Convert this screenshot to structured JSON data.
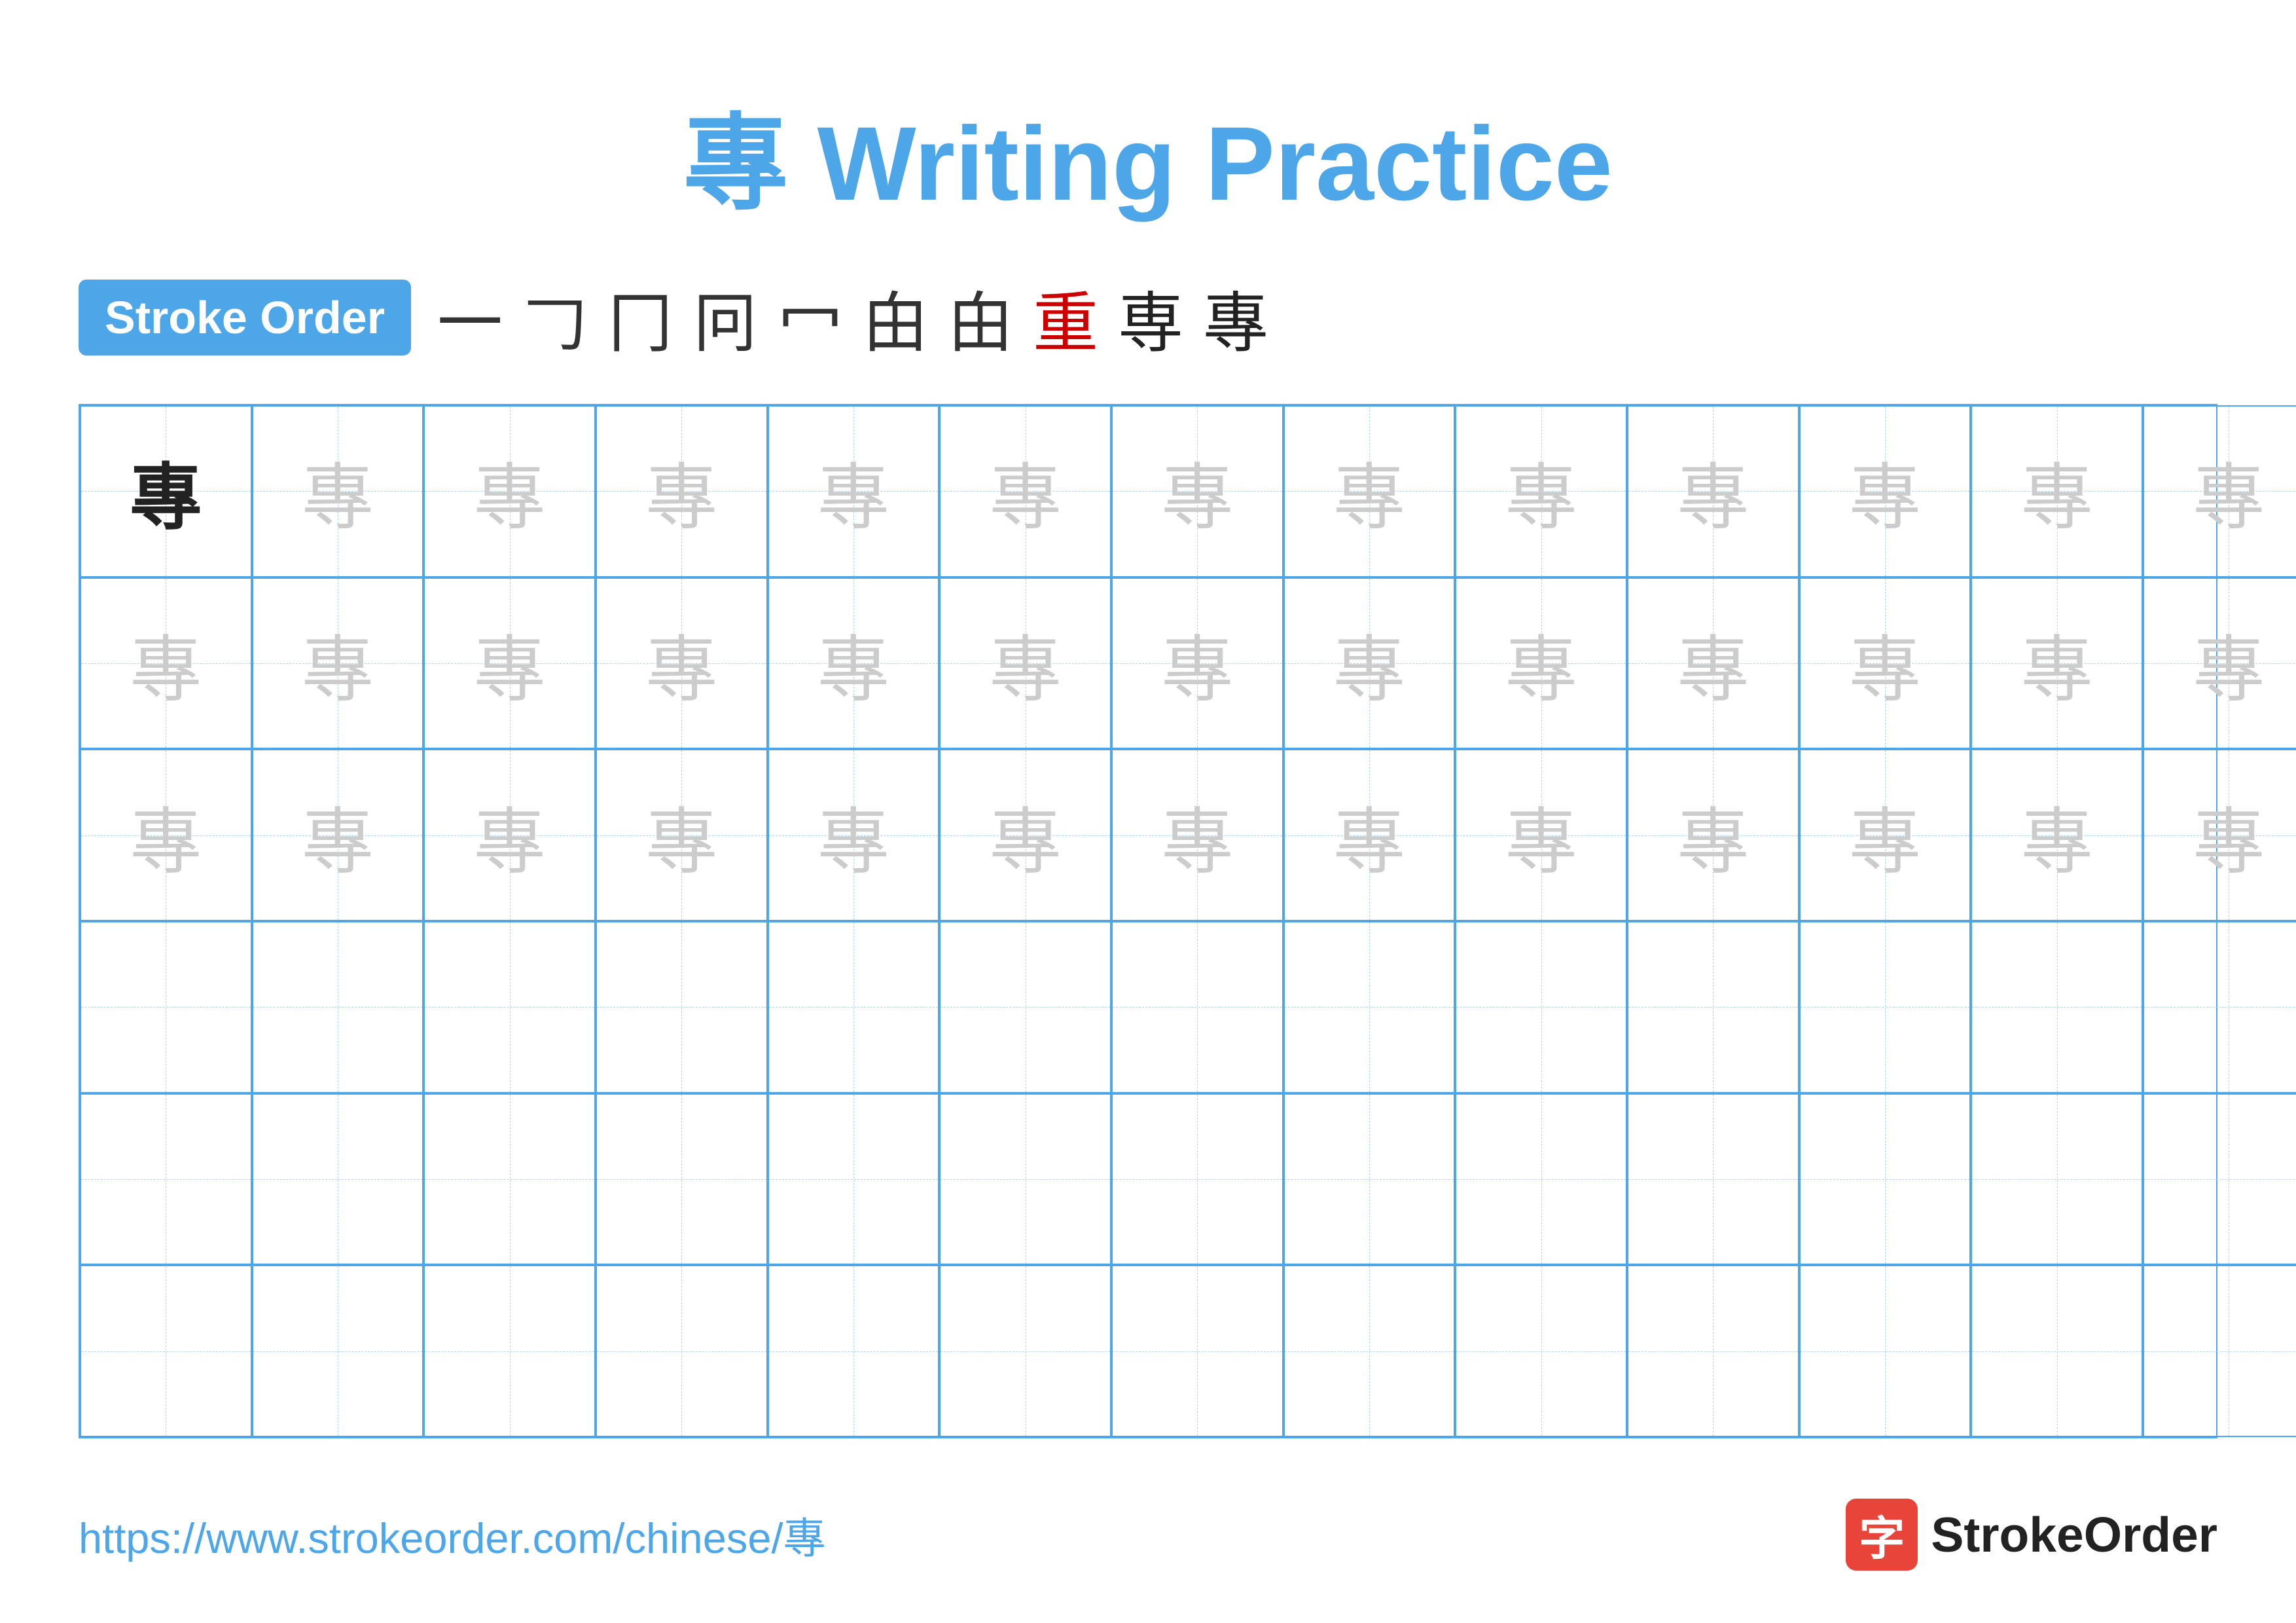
{
  "title": {
    "character": "專",
    "label": "Writing Practice",
    "full_title": "專 Writing Practice"
  },
  "stroke_order": {
    "badge_label": "Stroke Order",
    "strokes": [
      "一",
      "𠃌",
      "冂",
      "冋",
      "冖",
      "甶",
      "甶",
      "重",
      "専",
      "專"
    ]
  },
  "grid": {
    "rows": 6,
    "cols": 13,
    "character": "專",
    "example_positions": [
      0
    ],
    "guide_rows": [
      0,
      1,
      2
    ],
    "empty_rows": [
      3,
      4,
      5
    ]
  },
  "footer": {
    "url": "https://www.strokeorder.com/chinese/專",
    "logo_char": "字",
    "logo_name": "StrokeOrder"
  }
}
